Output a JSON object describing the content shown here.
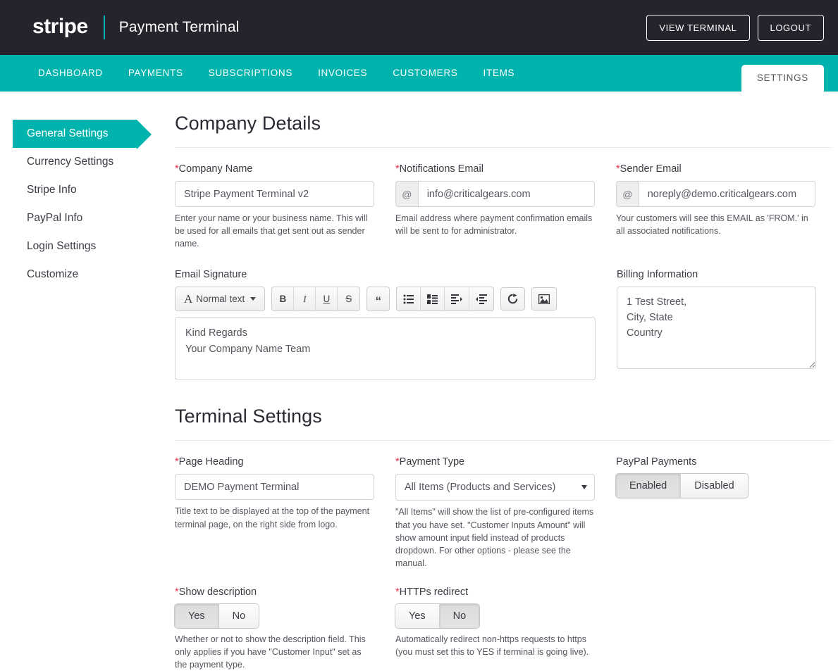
{
  "header": {
    "logo_text": "stripe",
    "app_title": "Payment Terminal",
    "view_terminal_label": "VIEW TERMINAL",
    "logout_label": "LOGOUT"
  },
  "nav": {
    "items": [
      {
        "label": "DASHBOARD"
      },
      {
        "label": "PAYMENTS"
      },
      {
        "label": "SUBSCRIPTIONS"
      },
      {
        "label": "INVOICES"
      },
      {
        "label": "CUSTOMERS"
      },
      {
        "label": "ITEMS"
      }
    ],
    "active_tab": "SETTINGS"
  },
  "sidebar": {
    "items": [
      {
        "label": "General Settings",
        "active": true
      },
      {
        "label": "Currency Settings",
        "active": false
      },
      {
        "label": "Stripe Info",
        "active": false
      },
      {
        "label": "PayPal Info",
        "active": false
      },
      {
        "label": "Login Settings",
        "active": false
      },
      {
        "label": "Customize",
        "active": false
      }
    ]
  },
  "company_details": {
    "title": "Company Details",
    "company_name": {
      "label": "Company Name",
      "required_mark": "*",
      "value": "Stripe Payment Terminal v2",
      "help": "Enter your name or your business name. This will be used for all emails that get sent out as sender name."
    },
    "notifications_email": {
      "label": "Notifications Email",
      "required_mark": "*",
      "addon": "@",
      "value": "info@criticalgears.com",
      "help": "Email address where payment confirmation emails will be sent to for administrator."
    },
    "sender_email": {
      "label": "Sender Email",
      "required_mark": "*",
      "addon": "@",
      "value": "noreply@demo.criticalgears.com",
      "help": "Your customers will see this EMAIL as 'FROM.' in all associated notifications."
    },
    "email_signature": {
      "label": "Email Signature",
      "style_label": "Normal text",
      "toolbar": [
        {
          "name": "bold-icon",
          "glyph": "B"
        },
        {
          "name": "italic-icon",
          "glyph": "I"
        },
        {
          "name": "underline-icon",
          "glyph": "U"
        },
        {
          "name": "strikethrough-icon",
          "glyph": "S"
        },
        {
          "name": "blockquote-icon",
          "glyph": "“"
        },
        {
          "name": "unordered-list-icon",
          "glyph": ""
        },
        {
          "name": "ordered-list-icon",
          "glyph": ""
        },
        {
          "name": "indent-icon",
          "glyph": ""
        },
        {
          "name": "outdent-icon",
          "glyph": ""
        },
        {
          "name": "link-icon",
          "glyph": ""
        },
        {
          "name": "image-icon",
          "glyph": ""
        }
      ],
      "content_line1": "Kind Regards",
      "content_line2": "Your Company Name Team"
    },
    "billing_information": {
      "label": "Billing Information",
      "value": "1 Test Street,\nCity, State\nCountry"
    }
  },
  "terminal_settings": {
    "title": "Terminal Settings",
    "page_heading": {
      "label": "Page Heading",
      "required_mark": "*",
      "value": "DEMO Payment Terminal",
      "help": "Title text to be displayed at the top of the payment terminal page, on the right side from logo."
    },
    "payment_type": {
      "label": "Payment Type",
      "required_mark": "*",
      "value": "All Items (Products and Services)",
      "options": [
        "All Items (Products and Services)",
        "Customer Inputs Amount"
      ],
      "help": "\"All Items\" will show the list of pre-configured items that you have set. \"Customer Inputs Amount\" will show amount input field instead of products dropdown. For other options - please see the manual."
    },
    "paypal_payments": {
      "label": "PayPal Payments",
      "options": [
        {
          "label": "Enabled",
          "selected": true
        },
        {
          "label": "Disabled",
          "selected": false
        }
      ]
    },
    "show_description": {
      "label": "Show description",
      "required_mark": "*",
      "options": [
        {
          "label": "Yes",
          "selected": true
        },
        {
          "label": "No",
          "selected": false
        }
      ],
      "help": "Whether or not to show the description field. This only applies if you have \"Customer Input\" set as the payment type."
    },
    "https_redirect": {
      "label": "HTTPs redirect",
      "required_mark": "*",
      "options": [
        {
          "label": "Yes",
          "selected": false
        },
        {
          "label": "No",
          "selected": true
        }
      ],
      "help": "Automatically redirect non-https requests to https (you must set this to YES if terminal is going live)."
    }
  },
  "colors": {
    "header_bg": "#24242c",
    "accent_teal": "#00b3ad",
    "required_red": "#e8314a",
    "text": "#3b3b45"
  }
}
